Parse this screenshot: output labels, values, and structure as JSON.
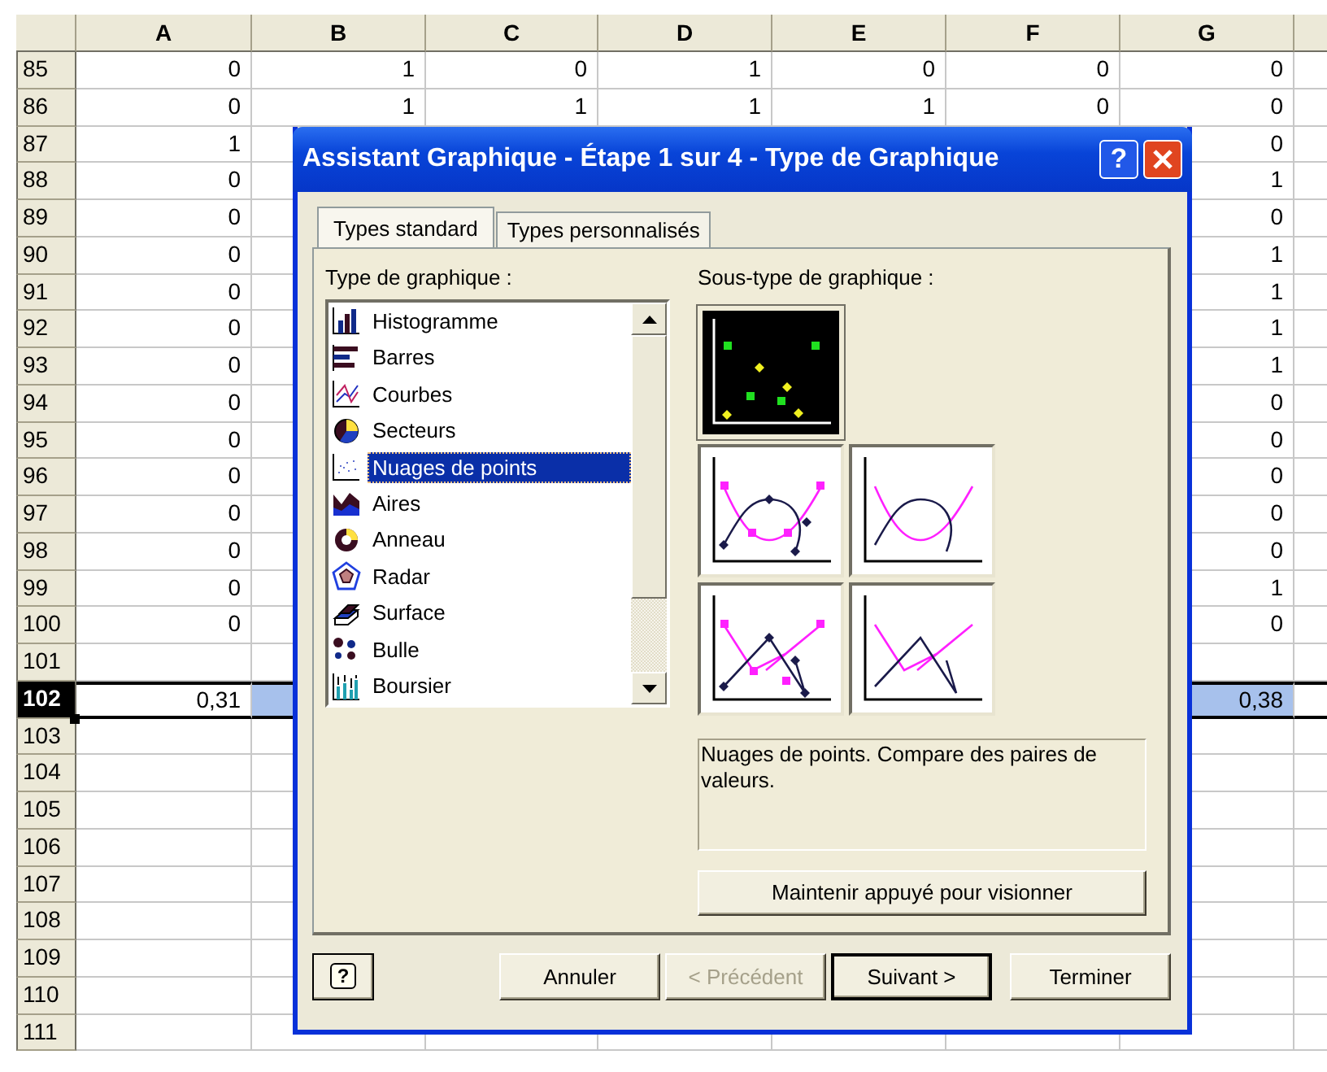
{
  "sheet": {
    "columns": [
      "A",
      "B",
      "C",
      "D",
      "E",
      "F",
      "G"
    ],
    "rows": [
      {
        "label": "85",
        "selected": false,
        "cells": [
          "0",
          "1",
          "0",
          "1",
          "0",
          "0",
          "0"
        ]
      },
      {
        "label": "86",
        "selected": false,
        "cells": [
          "0",
          "1",
          "1",
          "1",
          "1",
          "0",
          "0"
        ]
      },
      {
        "label": "87",
        "selected": false,
        "cells": [
          "1",
          null,
          null,
          null,
          null,
          null,
          "0"
        ]
      },
      {
        "label": "88",
        "selected": false,
        "cells": [
          "0",
          null,
          null,
          null,
          null,
          null,
          "1"
        ]
      },
      {
        "label": "89",
        "selected": false,
        "cells": [
          "0",
          null,
          null,
          null,
          null,
          null,
          "0"
        ]
      },
      {
        "label": "90",
        "selected": false,
        "cells": [
          "0",
          null,
          null,
          null,
          null,
          null,
          "1"
        ]
      },
      {
        "label": "91",
        "selected": false,
        "cells": [
          "0",
          null,
          null,
          null,
          null,
          null,
          "1"
        ]
      },
      {
        "label": "92",
        "selected": false,
        "cells": [
          "0",
          null,
          null,
          null,
          null,
          null,
          "1"
        ]
      },
      {
        "label": "93",
        "selected": false,
        "cells": [
          "0",
          null,
          null,
          null,
          null,
          null,
          "1"
        ]
      },
      {
        "label": "94",
        "selected": false,
        "cells": [
          "0",
          null,
          null,
          null,
          null,
          null,
          "0"
        ]
      },
      {
        "label": "95",
        "selected": false,
        "cells": [
          "0",
          null,
          null,
          null,
          null,
          null,
          "0"
        ]
      },
      {
        "label": "96",
        "selected": false,
        "cells": [
          "0",
          null,
          null,
          null,
          null,
          null,
          "0"
        ]
      },
      {
        "label": "97",
        "selected": false,
        "cells": [
          "0",
          null,
          null,
          null,
          null,
          null,
          "0"
        ]
      },
      {
        "label": "98",
        "selected": false,
        "cells": [
          "0",
          null,
          null,
          null,
          null,
          null,
          "0"
        ]
      },
      {
        "label": "99",
        "selected": false,
        "cells": [
          "0",
          null,
          null,
          null,
          null,
          null,
          "1"
        ]
      },
      {
        "label": "100",
        "selected": false,
        "cells": [
          "0",
          null,
          null,
          null,
          null,
          null,
          "0"
        ]
      },
      {
        "label": "101",
        "selected": false
      },
      {
        "label": "102",
        "selected": true,
        "cells": [
          "0,31",
          null,
          null,
          null,
          null,
          null,
          "0,38"
        ]
      },
      {
        "label": "103",
        "selected": false
      },
      {
        "label": "104",
        "selected": false
      },
      {
        "label": "105",
        "selected": false
      },
      {
        "label": "106",
        "selected": false
      },
      {
        "label": "107",
        "selected": false
      },
      {
        "label": "108",
        "selected": false
      },
      {
        "label": "109",
        "selected": false
      },
      {
        "label": "110",
        "selected": false
      },
      {
        "label": "111",
        "selected": false
      }
    ]
  },
  "dialog": {
    "title": "Assistant Graphique - Étape 1 sur 4 - Type de Graphique",
    "help_glyph": "?",
    "tabs": [
      {
        "label": "Types standard",
        "selected": true
      },
      {
        "label": "Types personnalisés",
        "selected": false
      }
    ],
    "chart_types": {
      "label": "Type de graphique :",
      "items": [
        {
          "label": "Histogramme",
          "kind": "column",
          "selected": false
        },
        {
          "label": "Barres",
          "kind": "bar",
          "selected": false
        },
        {
          "label": "Courbes",
          "kind": "line",
          "selected": false
        },
        {
          "label": "Secteurs",
          "kind": "pie",
          "selected": false
        },
        {
          "label": "Nuages de points",
          "kind": "scatter",
          "selected": true
        },
        {
          "label": "Aires",
          "kind": "area",
          "selected": false
        },
        {
          "label": "Anneau",
          "kind": "doughnut",
          "selected": false
        },
        {
          "label": "Radar",
          "kind": "radar",
          "selected": false
        },
        {
          "label": "Surface",
          "kind": "surface",
          "selected": false
        },
        {
          "label": "Bulle",
          "kind": "bubble",
          "selected": false
        },
        {
          "label": "Boursier",
          "kind": "stock",
          "selected": false
        }
      ]
    },
    "subtypes": {
      "label": "Sous-type de graphique :",
      "items": [
        {
          "kind": "markers",
          "selected": true
        },
        {
          "kind": "smooth-markers",
          "selected": false
        },
        {
          "kind": "smooth",
          "selected": false
        },
        {
          "kind": "line-markers",
          "selected": false
        },
        {
          "kind": "lines",
          "selected": false
        }
      ]
    },
    "description": "Nuages de points. Compare des paires de valeurs.",
    "preview_button": "Maintenir appuyé pour visionner",
    "help_button": "?",
    "buttons": [
      {
        "label": "Annuler",
        "disabled": false,
        "default": false
      },
      {
        "label": "< Précédent",
        "disabled": true,
        "default": false
      },
      {
        "label": "Suivant >",
        "disabled": false,
        "default": true
      },
      {
        "label": "Terminer",
        "disabled": false,
        "default": false
      }
    ]
  }
}
